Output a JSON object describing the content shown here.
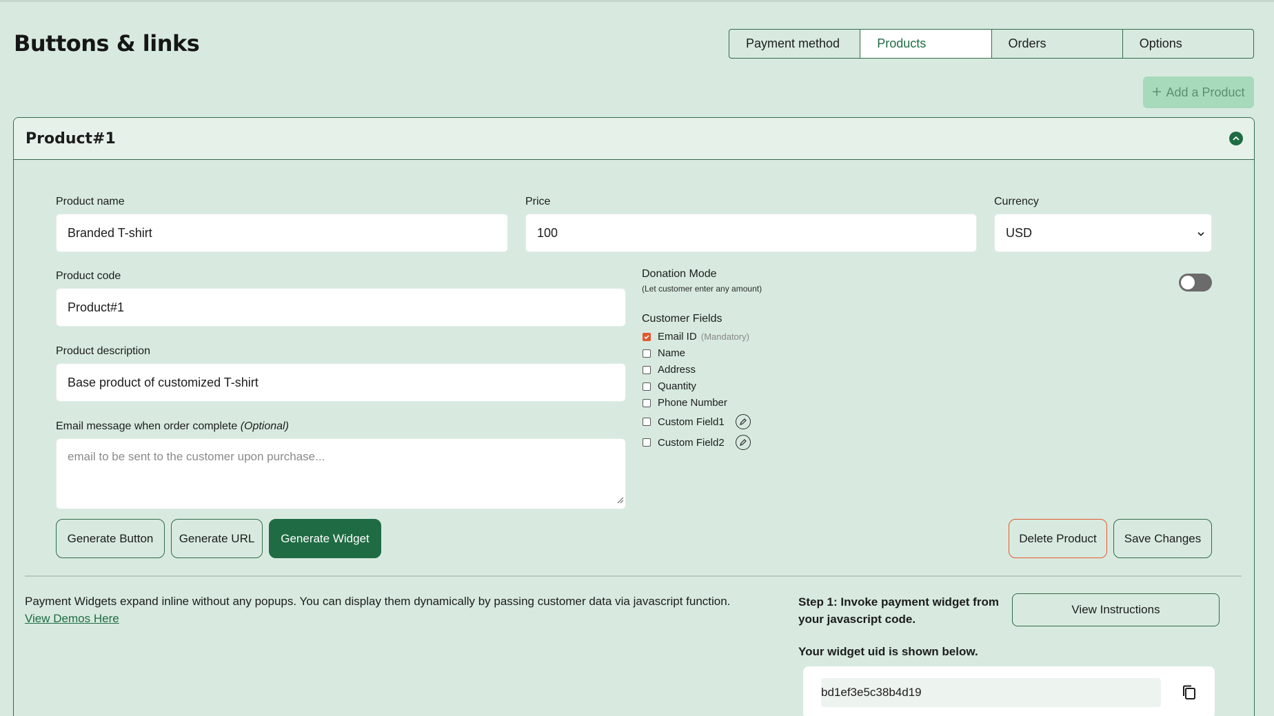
{
  "header": {
    "title": "Buttons & links",
    "tabs": [
      {
        "label": "Payment method",
        "active": false
      },
      {
        "label": "Products",
        "active": true
      },
      {
        "label": "Orders",
        "active": false
      },
      {
        "label": "Options",
        "active": false
      }
    ],
    "add_product_label": "Add a Product"
  },
  "product": {
    "title": "Product#1",
    "name_label": "Product name",
    "name_value": "Branded T-shirt",
    "price_label": "Price",
    "price_value": "100",
    "currency_label": "Currency",
    "currency_value": "USD",
    "code_label": "Product code",
    "code_value": "Product#1",
    "description_label": "Product description",
    "description_value": "Base product of customized T-shirt",
    "email_label": "Email message when order complete",
    "email_optional": "(Optional)",
    "email_placeholder": "email to be sent to the customer upon purchase...",
    "donation_title": "Donation Mode",
    "donation_sub": "(Let customer enter any amount)",
    "donation_enabled": false,
    "customer_fields_title": "Customer Fields",
    "customer_fields": [
      {
        "label": "Email ID",
        "note": "(Mandatory)",
        "checked": true
      },
      {
        "label": "Name",
        "checked": false
      },
      {
        "label": "Address",
        "checked": false
      },
      {
        "label": "Quantity",
        "checked": false
      },
      {
        "label": "Phone Number",
        "checked": false
      },
      {
        "label": "Custom Field1",
        "checked": false,
        "editable": true
      },
      {
        "label": "Custom Field2",
        "checked": false,
        "editable": true
      }
    ],
    "buttons": {
      "generate_button": "Generate Button",
      "generate_url": "Generate URL",
      "generate_widget": "Generate Widget",
      "delete_product": "Delete Product",
      "save_changes": "Save Changes"
    }
  },
  "widget": {
    "description": "Payment Widgets expand inline without any popups. You can display them dynamically by passing customer data via javascript function.",
    "demo_link": "View Demos Here",
    "step1": "Step 1: Invoke payment widget from your javascript code.",
    "view_instructions": "View Instructions",
    "uid_label": "Your widget uid is shown below.",
    "uid_value": "bd1ef3e5c38b4d19"
  },
  "colors": {
    "background": "#d8eadf",
    "accent": "#1f6b43",
    "danger": "#e4572e",
    "add_button_bg": "#a7d9bb"
  }
}
